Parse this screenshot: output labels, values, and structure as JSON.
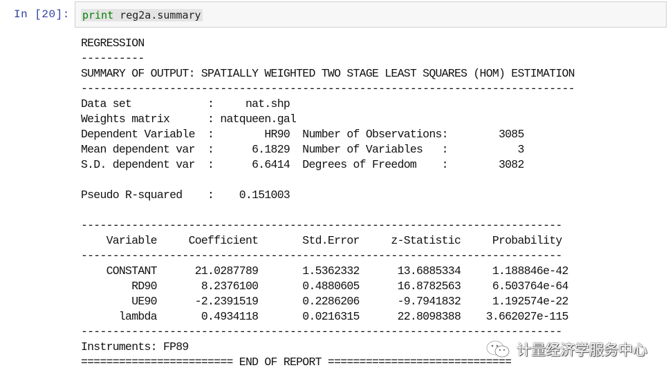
{
  "cell": {
    "prompt": "In  [20]:",
    "code_keyword": "print",
    "code_rest": " reg2a.summary"
  },
  "output": {
    "lines": [
      "REGRESSION",
      "----------",
      "SUMMARY OF OUTPUT: SPATIALLY WEIGHTED TWO STAGE LEAST SQUARES (HOM) ESTIMATION",
      "------------------------------------------------------------------------------",
      "Data set            :     nat.shp",
      "Weights matrix      : natqueen.gal",
      "Dependent Variable  :        HR90  Number of Observations:        3085",
      "Mean dependent var  :      6.1829  Number of Variables   :           3",
      "S.D. dependent var  :      6.6414  Degrees of Freedom    :        3082",
      "",
      "Pseudo R-squared    :    0.151003",
      "",
      "----------------------------------------------------------------------------",
      "    Variable     Coefficient       Std.Error     z-Statistic     Probability",
      "----------------------------------------------------------------------------",
      "    CONSTANT      21.0287789       1.5362332      13.6885334     1.188846e-42",
      "        RD90       8.2376100       0.4880605      16.8782563     6.503764e-64",
      "        UE90      -2.2391519       0.2286206      -9.7941832     1.192574e-22",
      "      lambda       0.4934118       0.0216315      22.8098388    3.662027e-115",
      "----------------------------------------------------------------------------",
      "Instruments: FP89",
      "======================== END OF REPORT ============================="
    ]
  },
  "watermark": {
    "text": "计量经济学服务中心",
    "icon": "wechat-icon"
  }
}
